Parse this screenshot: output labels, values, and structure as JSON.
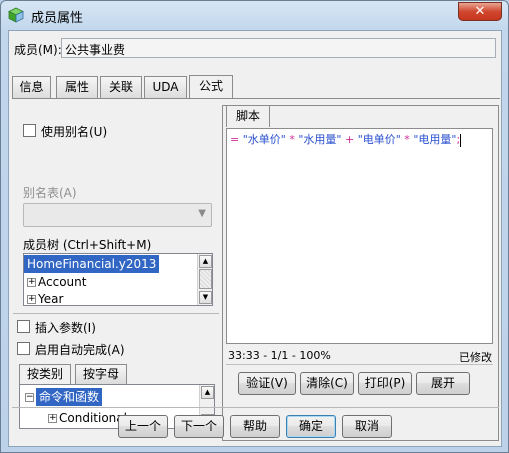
{
  "window": {
    "title": "成员属性",
    "close_glyph": "✕"
  },
  "member": {
    "label": "成员(M):",
    "value": "公共事业费"
  },
  "tabs": [
    {
      "label": "信息",
      "active": false
    },
    {
      "label": "属性",
      "active": false
    },
    {
      "label": "关联",
      "active": false
    },
    {
      "label": "UDA",
      "active": false
    },
    {
      "label": "公式",
      "active": true
    }
  ],
  "left": {
    "use_alias": {
      "label": "使用别名(U)",
      "checked": false
    },
    "alias_table": {
      "label": "别名表(A)",
      "value": "",
      "arrow": "▼"
    },
    "member_tree": {
      "label": "成员树 (Ctrl+Shift+M)",
      "items": [
        {
          "text": "HomeFinancial.y2013",
          "selected": true,
          "expander": ""
        },
        {
          "text": "Account",
          "selected": false,
          "expander": "+"
        },
        {
          "text": "Year",
          "selected": false,
          "expander": "+"
        }
      ]
    },
    "insert_params": {
      "label": "插入参数(I)",
      "checked": false
    },
    "auto_complete": {
      "label": "启用自动完成(A)",
      "checked": false
    },
    "sub_tabs": [
      {
        "label": "按类别",
        "active": true
      },
      {
        "label": "按字母",
        "active": false
      }
    ],
    "function_tree": {
      "items": [
        {
          "text": "命令和函数",
          "selected": true,
          "expander": "−"
        },
        {
          "text": "Conditionals",
          "selected": false,
          "expander": "+"
        }
      ]
    }
  },
  "script": {
    "tab_label": "脚本",
    "formula": {
      "eq": "= ",
      "t1": "\"水单价\"",
      "op1": " * ",
      "t2": "\"水用量\"",
      "op2": " + ",
      "t3": "\"电单价\"",
      "op3": " * ",
      "t4": "\"电用量\"",
      "end": ";"
    },
    "status_left": "33:33 - 1/1 - 100%",
    "status_right": "已修改",
    "buttons": {
      "verify": "验证(V)",
      "clear": "清除(C)",
      "print": "打印(P)",
      "expand": "展开"
    }
  },
  "footer": {
    "prev": "上一个",
    "next": "下一个",
    "help": "帮助",
    "ok": "确定",
    "cancel": "取消"
  },
  "colors": {
    "selection": "#3166c4",
    "operator": "#d02d99",
    "string": "#2a50d0"
  }
}
